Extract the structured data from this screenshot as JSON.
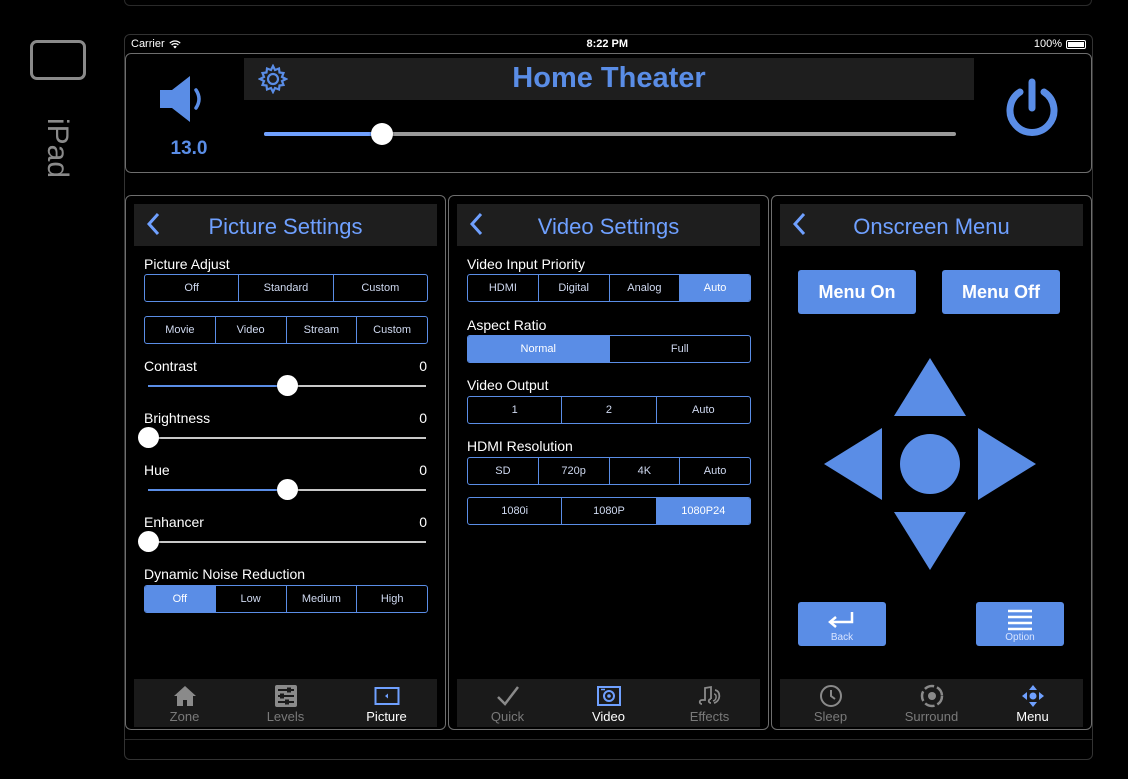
{
  "device": {
    "label": "iPad"
  },
  "status_bar": {
    "carrier": "Carrier",
    "time": "8:22 PM",
    "battery": "100%"
  },
  "header": {
    "title": "Home Theater",
    "volume": "13.0",
    "volume_slider_fraction": 0.17
  },
  "picture_settings": {
    "title": "Picture Settings",
    "picture_adjust_label": "Picture Adjust",
    "picture_adjust_row1": [
      "Off",
      "Standard",
      "Custom"
    ],
    "picture_adjust_row2": [
      "Movie",
      "Video",
      "Stream",
      "Custom"
    ],
    "contrast": {
      "label": "Contrast",
      "value": "0",
      "fraction": 0.5
    },
    "brightness": {
      "label": "Brightness",
      "value": "0",
      "fraction": 0.0
    },
    "hue": {
      "label": "Hue",
      "value": "0",
      "fraction": 0.5
    },
    "enhancer": {
      "label": "Enhancer",
      "value": "0",
      "fraction": 0.0
    },
    "dnr_label": "Dynamic Noise Reduction",
    "dnr_options": [
      "Off",
      "Low",
      "Medium",
      "High"
    ],
    "dnr_selected": "Off",
    "tabs": [
      "Zone",
      "Levels",
      "Picture"
    ],
    "active_tab": "Picture"
  },
  "video_settings": {
    "title": "Video Settings",
    "input_priority_label": "Video Input Priority",
    "input_priority_options": [
      "HDMI",
      "Digital",
      "Analog",
      "Auto"
    ],
    "input_priority_selected": "Auto",
    "aspect_label": "Aspect Ratio",
    "aspect_options": [
      "Normal",
      "Full"
    ],
    "aspect_selected": "Normal",
    "output_label": "Video Output",
    "output_options": [
      "1",
      "2",
      "Auto"
    ],
    "resolution_label": "HDMI Resolution",
    "resolution_row1": [
      "SD",
      "720p",
      "4K",
      "Auto"
    ],
    "resolution_row2": [
      "1080i",
      "1080P",
      "1080P24"
    ],
    "resolution_selected": "1080P24",
    "tabs": [
      "Quick",
      "Video",
      "Effects"
    ],
    "active_tab": "Video"
  },
  "onscreen_menu": {
    "title": "Onscreen Menu",
    "menu_on": "Menu On",
    "menu_off": "Menu Off",
    "back": "Back",
    "option": "Option",
    "tabs": [
      "Sleep",
      "Surround",
      "Menu"
    ],
    "active_tab": "Menu"
  },
  "colors": {
    "accent": "#5a8de6",
    "panel_header": "#1e1e1e",
    "background": "#000000"
  }
}
